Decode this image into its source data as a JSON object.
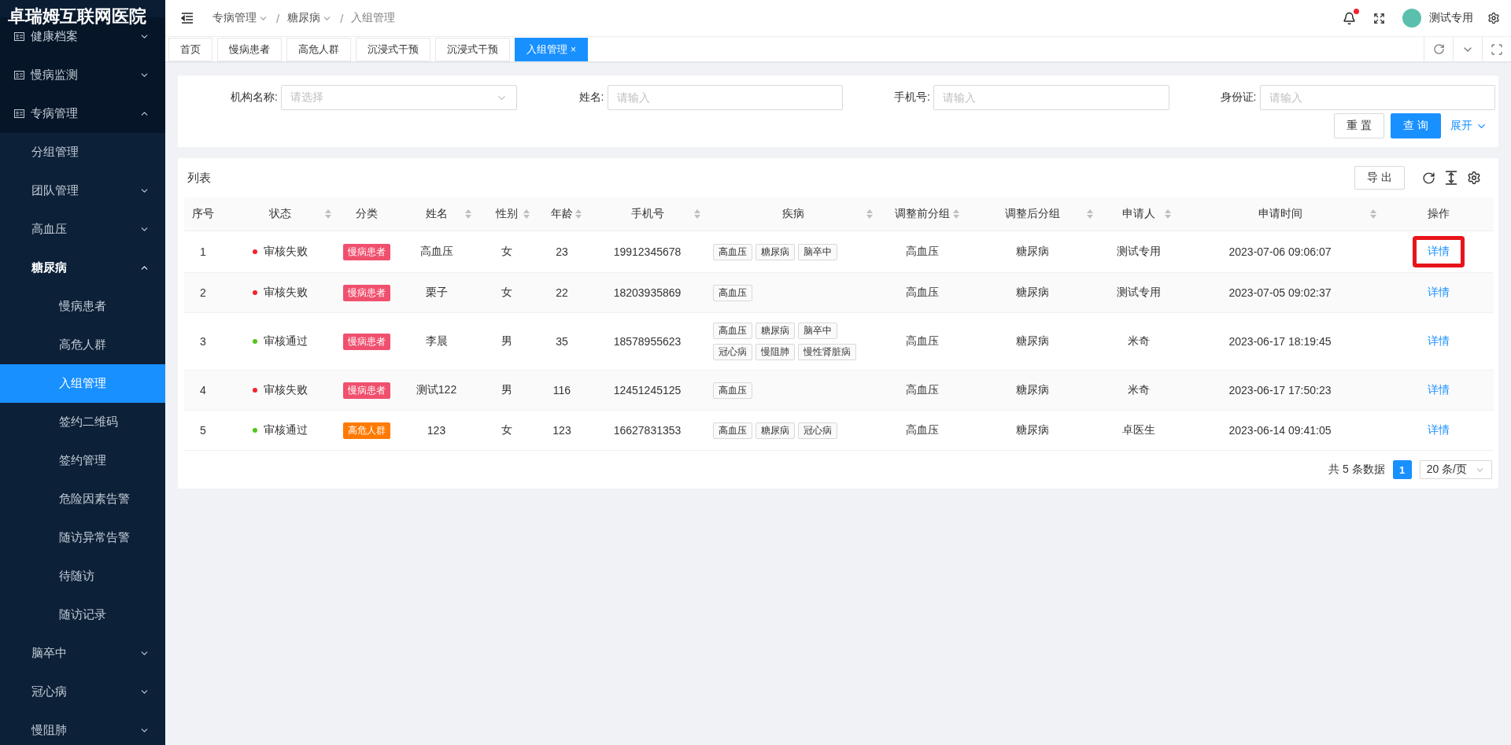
{
  "app_title": "卓瑞姆互联网医院",
  "sidebar": {
    "items": [
      {
        "label": "健康档案",
        "kind": "group",
        "selected": false,
        "expanded": false
      },
      {
        "label": "慢病监测",
        "kind": "group",
        "selected": false,
        "expanded": false
      },
      {
        "label": "专病管理",
        "kind": "group",
        "selected": false,
        "expanded": true,
        "children": [
          {
            "label": "分组管理",
            "kind": "leaf",
            "selected": false
          },
          {
            "label": "团队管理",
            "kind": "group",
            "selected": false,
            "expanded": false
          },
          {
            "label": "高血压",
            "kind": "group",
            "selected": false,
            "expanded": false
          },
          {
            "label": "糖尿病",
            "kind": "group",
            "selected": false,
            "expanded": true,
            "children": [
              {
                "label": "慢病患者",
                "kind": "leaf",
                "selected": false
              },
              {
                "label": "高危人群",
                "kind": "leaf",
                "selected": false
              },
              {
                "label": "入组管理",
                "kind": "leaf",
                "selected": true
              },
              {
                "label": "签约二维码",
                "kind": "leaf",
                "selected": false
              },
              {
                "label": "签约管理",
                "kind": "leaf",
                "selected": false
              },
              {
                "label": "危险因素告警",
                "kind": "leaf",
                "selected": false
              },
              {
                "label": "随访异常告警",
                "kind": "leaf",
                "selected": false
              },
              {
                "label": "待随访",
                "kind": "leaf",
                "selected": false
              },
              {
                "label": "随访记录",
                "kind": "leaf",
                "selected": false
              }
            ]
          },
          {
            "label": "脑卒中",
            "kind": "group",
            "selected": false,
            "expanded": false
          },
          {
            "label": "冠心病",
            "kind": "group",
            "selected": false,
            "expanded": false
          },
          {
            "label": "慢阻肺",
            "kind": "group",
            "selected": false,
            "expanded": false
          }
        ]
      }
    ]
  },
  "header": {
    "breadcrumbs": [
      {
        "label": "专病管理",
        "dropdown": true
      },
      {
        "label": "糖尿病",
        "dropdown": true
      },
      {
        "label": "入组管理",
        "dropdown": false
      }
    ],
    "separator": "/",
    "notification_dot": true,
    "user": "测试专用"
  },
  "tabs": [
    {
      "label": "首页",
      "selected": false,
      "closable": false
    },
    {
      "label": "慢病患者",
      "selected": false,
      "closable": false
    },
    {
      "label": "高危人群",
      "selected": false,
      "closable": false
    },
    {
      "label": "沉浸式干预",
      "selected": false,
      "closable": false
    },
    {
      "label": "沉浸式干预",
      "selected": false,
      "closable": false
    },
    {
      "label": "入组管理",
      "selected": true,
      "closable": true,
      "close": "×"
    }
  ],
  "search": {
    "fields": [
      {
        "kind": "select",
        "label": "机构名称:",
        "placeholder": "请选择"
      },
      {
        "kind": "input",
        "label": "姓名:",
        "placeholder": "请输入"
      },
      {
        "kind": "input",
        "label": "手机号:",
        "placeholder": "请输入"
      },
      {
        "kind": "input",
        "label": "身份证:",
        "placeholder": "请输入"
      }
    ],
    "reset": "重 置",
    "query": "查 询",
    "expand": "展开"
  },
  "table": {
    "title": "列表",
    "export": "导 出",
    "columns": [
      {
        "label": "序号",
        "sortable": false
      },
      {
        "label": "状态",
        "sortable": true
      },
      {
        "label": "分类",
        "sortable": false
      },
      {
        "label": "姓名",
        "sortable": true
      },
      {
        "label": "性别",
        "sortable": true
      },
      {
        "label": "年龄",
        "sortable": true
      },
      {
        "label": "手机号",
        "sortable": true
      },
      {
        "label": "疾病",
        "sortable": true
      },
      {
        "label": "调整前分组",
        "sortable": true
      },
      {
        "label": "调整后分组",
        "sortable": true
      },
      {
        "label": "申请人",
        "sortable": true
      },
      {
        "label": "申请时间",
        "sortable": true
      },
      {
        "label": "操作",
        "sortable": false
      }
    ],
    "rows": [
      {
        "no": "1",
        "status": {
          "text": "审核失败",
          "color": "#f5222d"
        },
        "category": {
          "text": "慢病患者",
          "color": "#f0506e"
        },
        "name": "高血压",
        "gender": "女",
        "age": "23",
        "phone": "19912345678",
        "diseases": [
          "高血压",
          "糖尿病",
          "脑卒中"
        ],
        "before": "高血压",
        "after": "糖尿病",
        "applicant": "测试专用",
        "time": "2023-07-06 09:06:07",
        "action": "详情",
        "highlighted": true
      },
      {
        "no": "2",
        "status": {
          "text": "审核失败",
          "color": "#f5222d"
        },
        "category": {
          "text": "慢病患者",
          "color": "#f0506e"
        },
        "name": "栗子",
        "gender": "女",
        "age": "22",
        "phone": "18203935869",
        "diseases": [
          "高血压"
        ],
        "before": "高血压",
        "after": "糖尿病",
        "applicant": "测试专用",
        "time": "2023-07-05 09:02:37",
        "action": "详情",
        "highlighted": false
      },
      {
        "no": "3",
        "status": {
          "text": "审核通过",
          "color": "#52c41a"
        },
        "category": {
          "text": "慢病患者",
          "color": "#f0506e"
        },
        "name": "李晨",
        "gender": "男",
        "age": "35",
        "phone": "18578955623",
        "diseases": [
          "高血压",
          "糖尿病",
          "脑卒中",
          "冠心病",
          "慢阻肺",
          "慢性肾脏病"
        ],
        "before": "高血压",
        "after": "糖尿病",
        "applicant": "米奇",
        "time": "2023-06-17 18:19:45",
        "action": "详情",
        "highlighted": false
      },
      {
        "no": "4",
        "status": {
          "text": "审核失败",
          "color": "#f5222d"
        },
        "category": {
          "text": "慢病患者",
          "color": "#f0506e"
        },
        "name": "测试122",
        "gender": "男",
        "age": "116",
        "phone": "12451245125",
        "diseases": [
          "高血压"
        ],
        "before": "高血压",
        "after": "糖尿病",
        "applicant": "米奇",
        "time": "2023-06-17 17:50:23",
        "action": "详情",
        "highlighted": false
      },
      {
        "no": "5",
        "status": {
          "text": "审核通过",
          "color": "#52c41a"
        },
        "category": {
          "text": "高危人群",
          "color": "#ff7a00"
        },
        "name": "123",
        "gender": "女",
        "age": "123",
        "phone": "16627831353",
        "diseases": [
          "高血压",
          "糖尿病",
          "冠心病"
        ],
        "before": "高血压",
        "after": "糖尿病",
        "applicant": "卓医生",
        "time": "2023-06-14 09:41:05",
        "action": "详情",
        "highlighted": false
      }
    ]
  },
  "pagination": {
    "total": "共 5 条数据",
    "pages": [
      {
        "label": "1",
        "selected": true
      }
    ],
    "page_size": "20 条/页"
  }
}
